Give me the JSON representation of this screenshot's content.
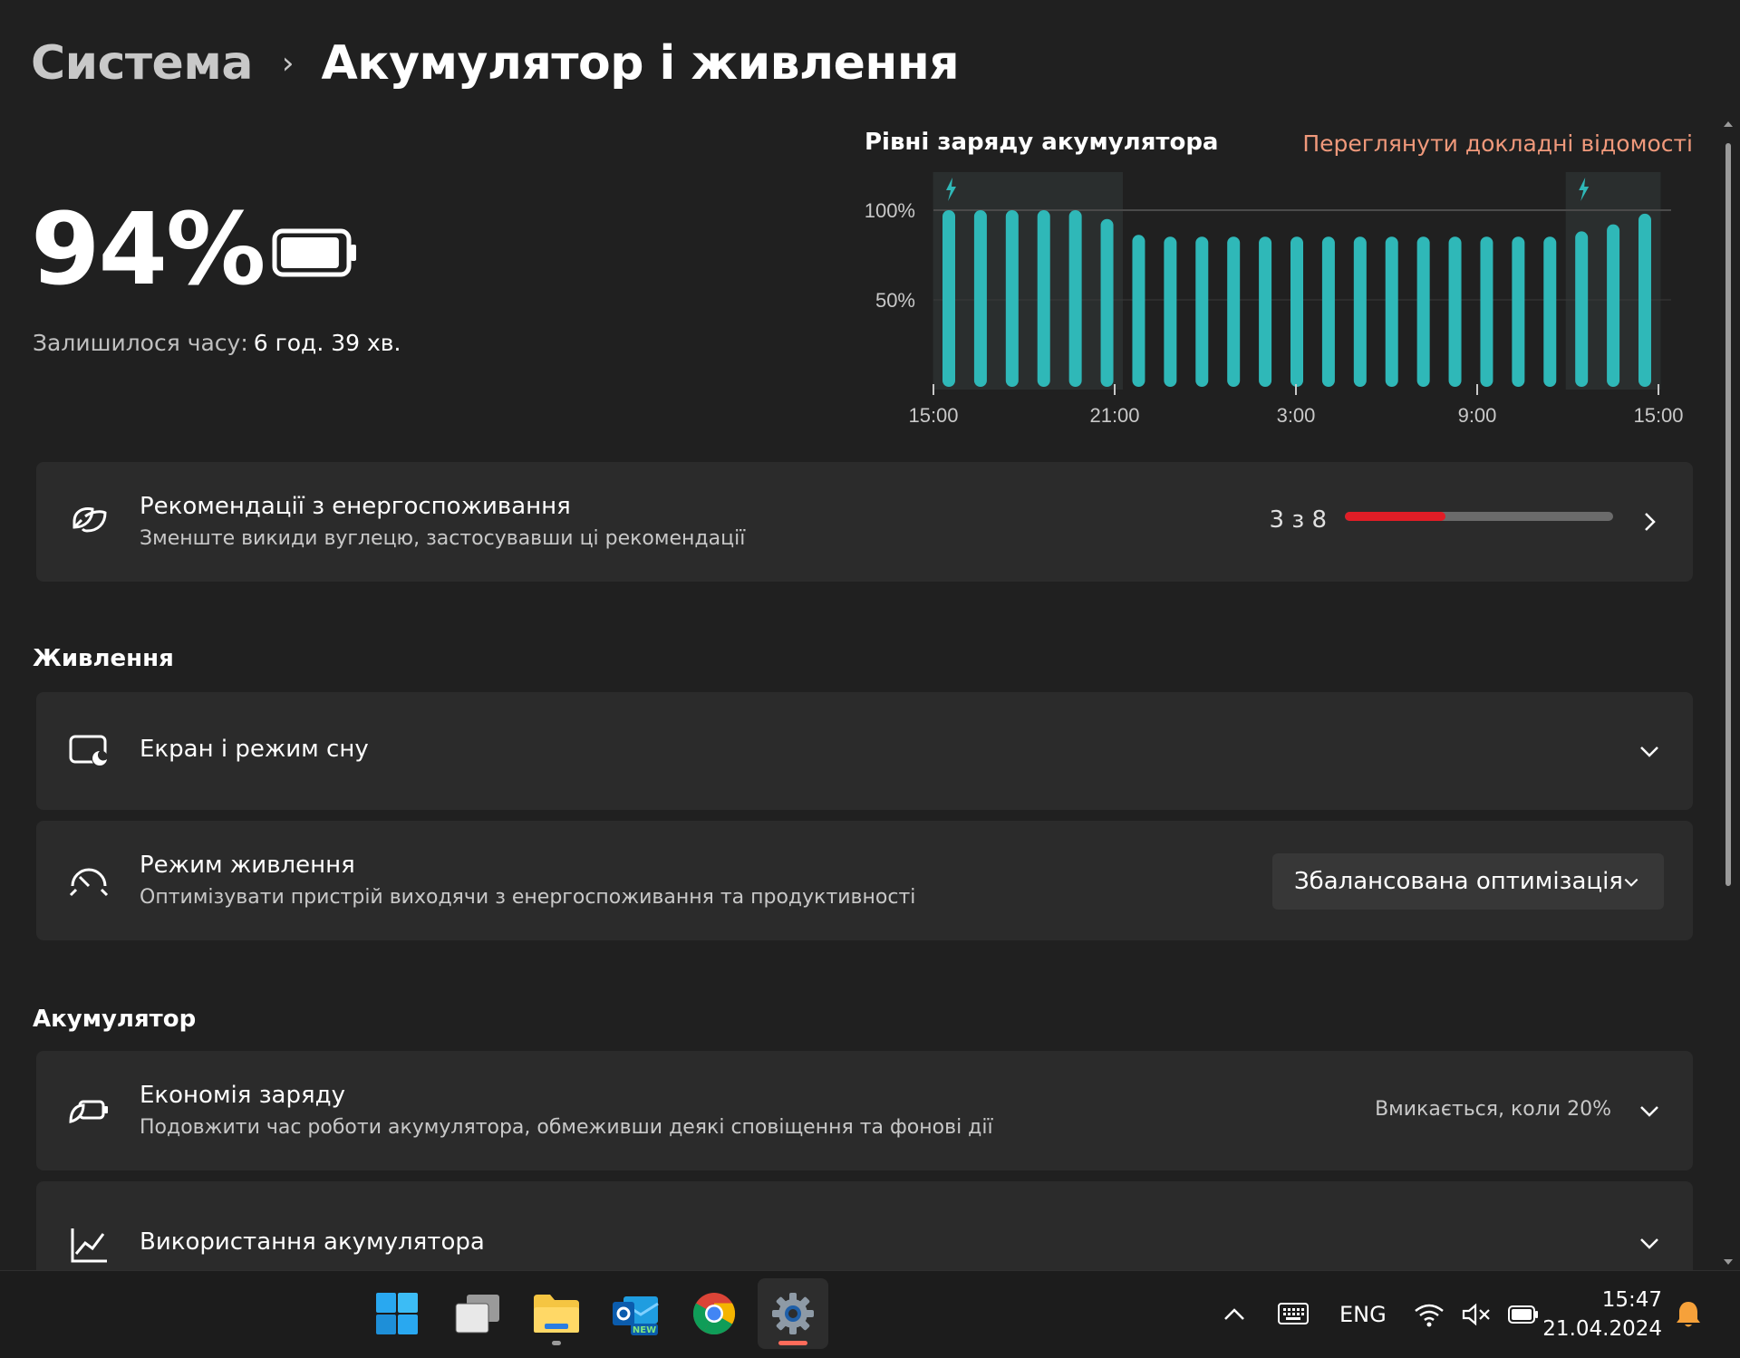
{
  "breadcrumb": {
    "parent": "Система",
    "separator": "›",
    "current": "Акумулятор і живлення"
  },
  "battery": {
    "percent": "94%",
    "level": 0.94,
    "remaining_label": "Залишилося часу:",
    "remaining_value": "6 год. 39 хв."
  },
  "chart_data": {
    "type": "bar",
    "title": "Рівні заряду акумулятора",
    "x_ticks": [
      "15:00",
      "21:00",
      "3:00",
      "9:00",
      "15:00"
    ],
    "y_ticks": [
      "100%",
      "50%"
    ],
    "ylim": [
      0,
      100
    ],
    "values": [
      100,
      100,
      100,
      100,
      100,
      95,
      86,
      85,
      85,
      85,
      85,
      85,
      85,
      85,
      85,
      85,
      85,
      85,
      85,
      85,
      88,
      92,
      98
    ],
    "charging_periods": [
      [
        0,
        5
      ],
      [
        20,
        22
      ]
    ],
    "bar_color": "#2fb8b8",
    "link_label": "Переглянути докладні відомості"
  },
  "recommendations": {
    "title": "Рекомендації з енергоспоживання",
    "subtitle": "Зменште викиди вуглецю, застосувавши ці рекомендації",
    "progress_label": "3 з 8",
    "progress_done": 3,
    "progress_total": 8,
    "progress_color": "#e11d26"
  },
  "power_section": {
    "header": "Живлення",
    "screen_sleep": {
      "title": "Екран і режим сну"
    },
    "power_mode": {
      "title": "Режим живлення",
      "subtitle": "Оптимізувати пристрій виходячи з енергоспоживання та продуктивності",
      "selected": "Збалансована оптимізація"
    }
  },
  "battery_section": {
    "header": "Акумулятор",
    "saver": {
      "title": "Економія заряду",
      "subtitle": "Подовжити час роботи акумулятора, обмеживши деякі сповіщення та фонові дії",
      "status": "Вмикається, коли 20%"
    },
    "usage": {
      "title": "Використання акумулятора"
    }
  },
  "taskbar": {
    "apps": [
      "start-icon",
      "task-view-icon",
      "file-explorer-icon",
      "outlook-new-icon",
      "chrome-icon",
      "settings-icon"
    ],
    "outlook_badge": "NEW",
    "language": "ENG",
    "time": "15:47",
    "date": "21.04.2024"
  }
}
